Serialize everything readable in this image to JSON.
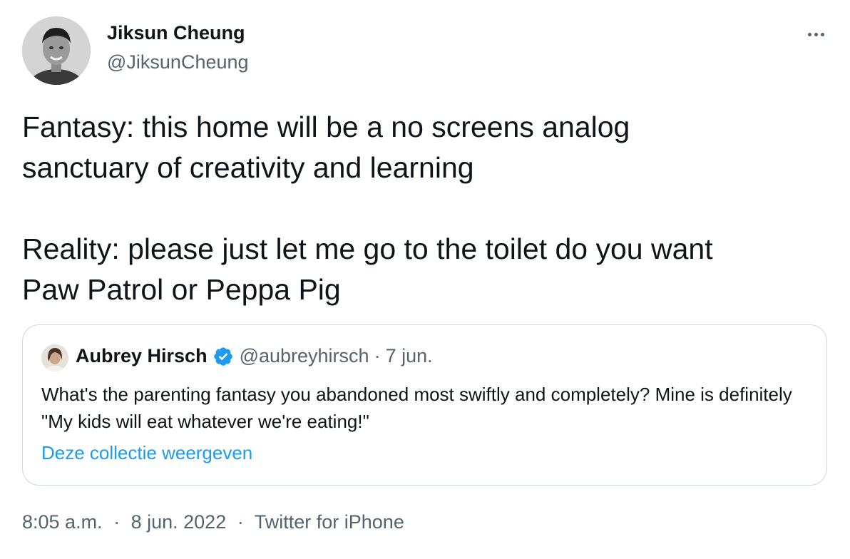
{
  "author": {
    "name": "Jiksun Cheung",
    "handle": "@JiksunCheung",
    "avatar_icon": "profile-photo"
  },
  "more_icon": "more-horizontal-icon",
  "tweet": {
    "paragraph_1": "Fantasy: this home will be a no screens analog\nsanctuary of creativity and learning",
    "paragraph_2": "Reality: please just let me go to the toilet do you want\nPaw Patrol or Peppa Pig"
  },
  "quote": {
    "name": "Aubrey Hirsch",
    "verified_icon": "verified-badge-icon",
    "handle": "@aubreyhirsch",
    "separator": "·",
    "date": "7 jun.",
    "text": "What's the parenting fantasy you abandoned most swiftly and completely? Mine is definitely \"My kids will eat whatever we're eating!\"",
    "link": "Deze collectie weergeven"
  },
  "meta": {
    "time": "8:05 a.m.",
    "separator": "·",
    "date": "8 jun. 2022",
    "source": "Twitter for iPhone"
  },
  "colors": {
    "text_primary": "#0f1419",
    "text_secondary": "#536471",
    "link": "#1d9bf0",
    "verified": "#1d9bf0",
    "border": "#cfd9de"
  }
}
